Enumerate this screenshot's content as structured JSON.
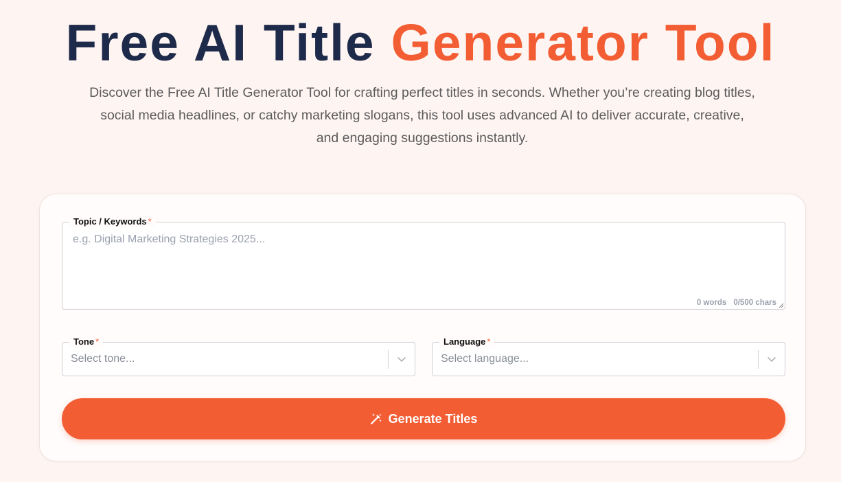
{
  "hero": {
    "title_part1": "Free AI Title ",
    "title_part2": "Generator Tool",
    "subtitle": "Discover the Free AI Title Generator Tool for crafting perfect titles in seconds. Whether you’re creating blog titles, social media headlines, or catchy marketing slogans, this tool uses advanced AI to deliver accurate, creative, and engaging suggestions instantly."
  },
  "form": {
    "topic": {
      "label": "Topic / Keywords",
      "required_mark": "*",
      "placeholder": "e.g. Digital Marketing Strategies 2025...",
      "word_count": "0 words",
      "char_count": "0/500 chars"
    },
    "tone": {
      "label": "Tone",
      "required_mark": "*",
      "placeholder": "Select tone..."
    },
    "language": {
      "label": "Language",
      "required_mark": "*",
      "placeholder": "Select language..."
    },
    "submit": {
      "label": "Generate Titles",
      "icon": "magic-wand-icon"
    }
  },
  "colors": {
    "background": "#fef5f3",
    "title_dark": "#1e2a4a",
    "accent": "#f35d33"
  }
}
